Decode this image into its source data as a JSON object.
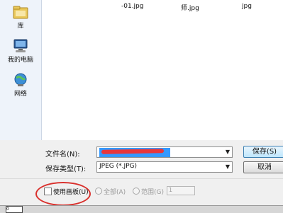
{
  "places": [
    {
      "label": "库",
      "icon": "library-folder-icon"
    },
    {
      "label": "我的电脑",
      "icon": "computer-icon"
    },
    {
      "label": "网络",
      "icon": "network-globe-icon"
    }
  ],
  "files": [
    {
      "name": "-01.jpg"
    },
    {
      "name": "师.jpg"
    },
    {
      "name": "jpg"
    }
  ],
  "fields": {
    "filename_label": "文件名(N):",
    "filetype_label": "保存类型(T):",
    "filetype_value": "JPEG (*.JPG)"
  },
  "buttons": {
    "save": "保存(S)",
    "cancel": "取消"
  },
  "options": {
    "use_artboard": "使用画板(U)",
    "all": "全部(A)",
    "range": "范围(G)",
    "range_value": "1"
  },
  "status": {
    "box_text": "0"
  },
  "colors": {
    "annotation_circle": "#d9302c",
    "redaction": "#e8363a",
    "selection": "#3399ff"
  }
}
